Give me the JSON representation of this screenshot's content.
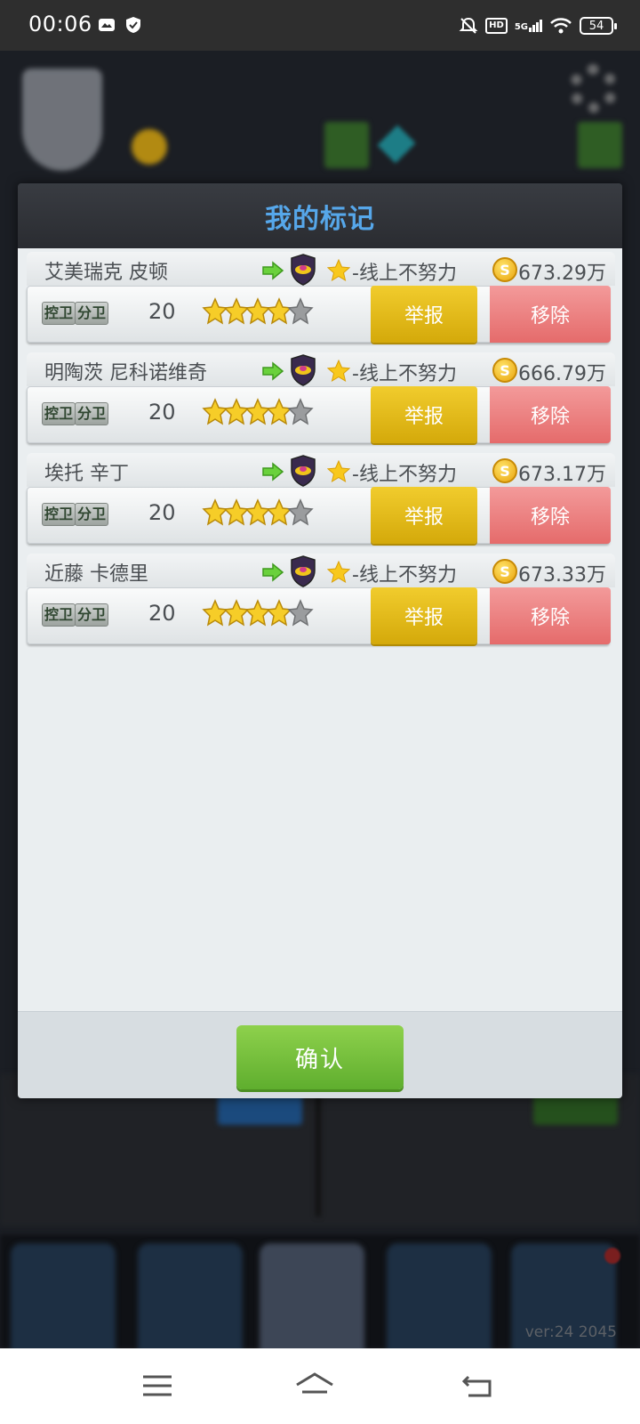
{
  "status_bar": {
    "time": "00:06",
    "hd_label": "HD",
    "network_label": "5G",
    "battery": "54"
  },
  "background": {
    "version": "ver:24  2045"
  },
  "modal": {
    "title": "我的标记",
    "confirm_label": "确认"
  },
  "players": [
    {
      "name": "艾美瑞克 皮顿",
      "team": "-线上不努力",
      "value": "673.29万",
      "positions": [
        "控卫",
        "分卫"
      ],
      "age": "20",
      "stars": 4,
      "report_label": "举报",
      "remove_label": "移除"
    },
    {
      "name": "明陶茨 尼科诺维奇",
      "team": "-线上不努力",
      "value": "666.79万",
      "positions": [
        "控卫",
        "分卫"
      ],
      "age": "20",
      "stars": 4,
      "report_label": "举报",
      "remove_label": "移除"
    },
    {
      "name": "埃托 辛丁",
      "team": "-线上不努力",
      "value": "673.17万",
      "positions": [
        "控卫",
        "分卫"
      ],
      "age": "20",
      "stars": 4,
      "report_label": "举报",
      "remove_label": "移除"
    },
    {
      "name": "近藤 卡德里",
      "team": "-线上不努力",
      "value": "673.33万",
      "positions": [
        "控卫",
        "分卫"
      ],
      "age": "20",
      "stars": 4,
      "report_label": "举报",
      "remove_label": "移除"
    }
  ],
  "colors": {
    "title_blue": "#56a7ea",
    "report_yellow": "#e2b91a",
    "remove_red": "#ea7a7a",
    "confirm_green": "#74c03c"
  },
  "icons": {
    "transfer": "green-arrow-icon",
    "club": "club-badge-icon",
    "favorite": "star-icon",
    "currency": "coin-icon",
    "rating": "rating-star-icon"
  }
}
